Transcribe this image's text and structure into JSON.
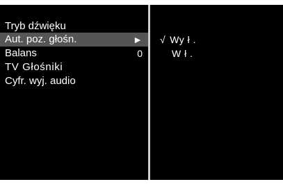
{
  "menu": {
    "items": [
      {
        "label": "Tryb dźwięku",
        "value": ""
      },
      {
        "label": "Aut. poz. głośn.",
        "value": "►",
        "selected": true
      },
      {
        "label": "Balans",
        "value": "0"
      },
      {
        "label": "TV Głośniki",
        "value": ""
      },
      {
        "label": "Cyfr. wyj. audio",
        "value": ""
      }
    ]
  },
  "submenu": {
    "check_mark": "√",
    "options": [
      {
        "label": "Wy ł .",
        "checked": true
      },
      {
        "label": "W ł .",
        "checked": false
      }
    ]
  },
  "colors": {
    "background": "#000000",
    "text": "#ffffff",
    "selected_highlight": "#555555",
    "divider": "#cfcfcf"
  }
}
